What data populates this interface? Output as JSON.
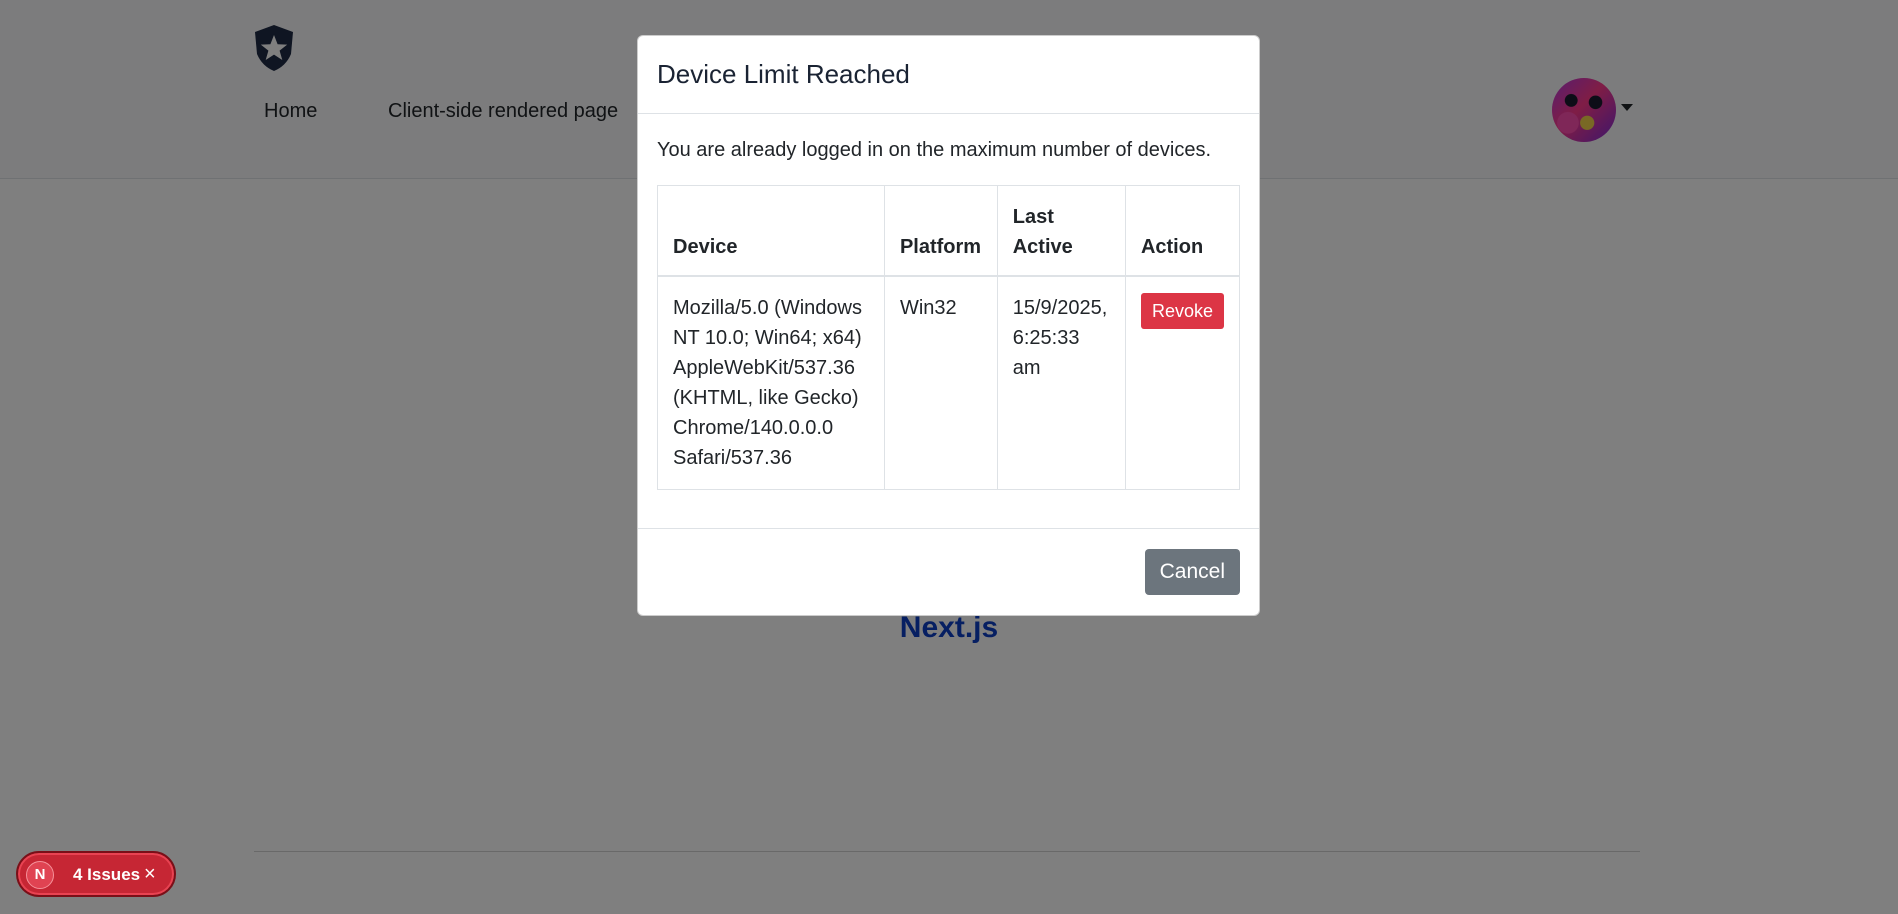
{
  "nav": {
    "items": [
      {
        "label": "Home"
      },
      {
        "label": "Client-side rendered page"
      }
    ]
  },
  "main": {
    "link_text": "Next.js"
  },
  "modal": {
    "title": "Device Limit Reached",
    "message": "You are already logged in on the maximum number of devices.",
    "table": {
      "headers": {
        "device": "Device",
        "platform": "Platform",
        "last_active": "Last Active",
        "action": "Action"
      },
      "rows": [
        {
          "device": "Mozilla/5.0 (Windows NT 10.0; Win64; x64) AppleWebKit/537.36 (KHTML, like Gecko) Chrome/140.0.0.0 Safari/537.36",
          "platform": "Win32",
          "last_active": "15/9/2025, 6:25:33 am",
          "action_label": "Revoke"
        }
      ]
    },
    "cancel_label": "Cancel"
  },
  "dev_overlay": {
    "badge_letter": "N",
    "issues_label": "4 Issues",
    "close_glyph": "×"
  },
  "colors": {
    "danger": "#dc3545",
    "secondary": "#6c757d",
    "link": "#0d3ec4"
  }
}
